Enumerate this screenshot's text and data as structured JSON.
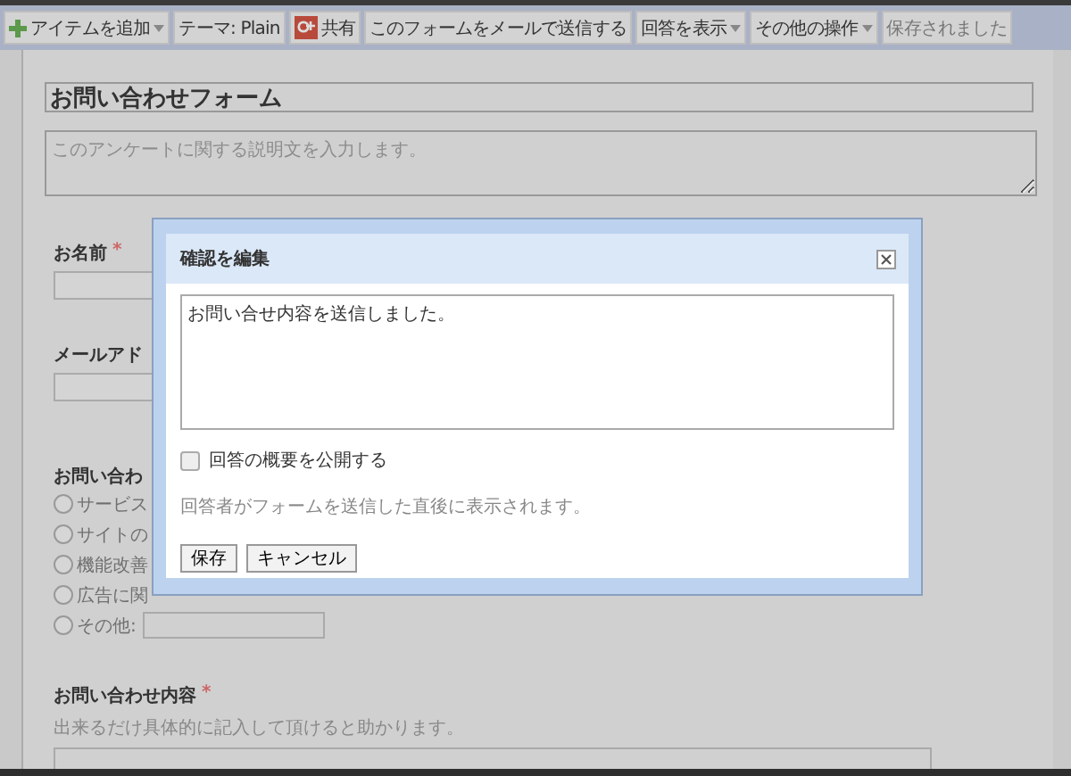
{
  "toolbar": [
    {
      "kind": "add",
      "label": "アイテムを追加",
      "caret": true
    },
    {
      "kind": "plain",
      "label": "テーマ: Plain",
      "caret": false
    },
    {
      "kind": "share",
      "label": "共有",
      "caret": false
    },
    {
      "kind": "plain",
      "label": "このフォームをメールで送信する",
      "caret": false
    },
    {
      "kind": "plain",
      "label": "回答を表示",
      "caret": true
    },
    {
      "kind": "plain",
      "label": "その他の操作",
      "caret": true
    },
    {
      "kind": "status",
      "label": "保存されました",
      "caret": false
    }
  ],
  "form": {
    "title": "お問い合わせフォーム",
    "description_placeholder": "このアンケートに関する説明文を入力します。",
    "questions": [
      {
        "kind": "text",
        "label": "お名前",
        "required_mark": "*"
      },
      {
        "kind": "text",
        "label": "メールアド"
      },
      {
        "kind": "radio",
        "label": "お問い合わ",
        "options": [
          {
            "label": "サービス",
            "selected": false,
            "other": false
          },
          {
            "label": "サイトの",
            "selected": false,
            "other": false
          },
          {
            "label": "機能改善",
            "selected": false,
            "other": false
          },
          {
            "label": "広告に関",
            "selected": false,
            "other": false
          },
          {
            "label": "その他:",
            "selected": false,
            "other": true
          }
        ]
      },
      {
        "kind": "paragraph",
        "label": "お問い合わせ内容",
        "required_mark": "*",
        "help": "出来るだけ具体的に記入して頂けると助かります。"
      }
    ]
  },
  "dialog": {
    "title": "確認を編集",
    "message": "お問い合せ内容を送信しました。",
    "publish_summary": {
      "label": "回答の概要を公開する",
      "checked": false
    },
    "note": "回答者がフォームを送信した直後に表示されます。",
    "buttons": [
      "保存",
      "キャンセル"
    ]
  }
}
